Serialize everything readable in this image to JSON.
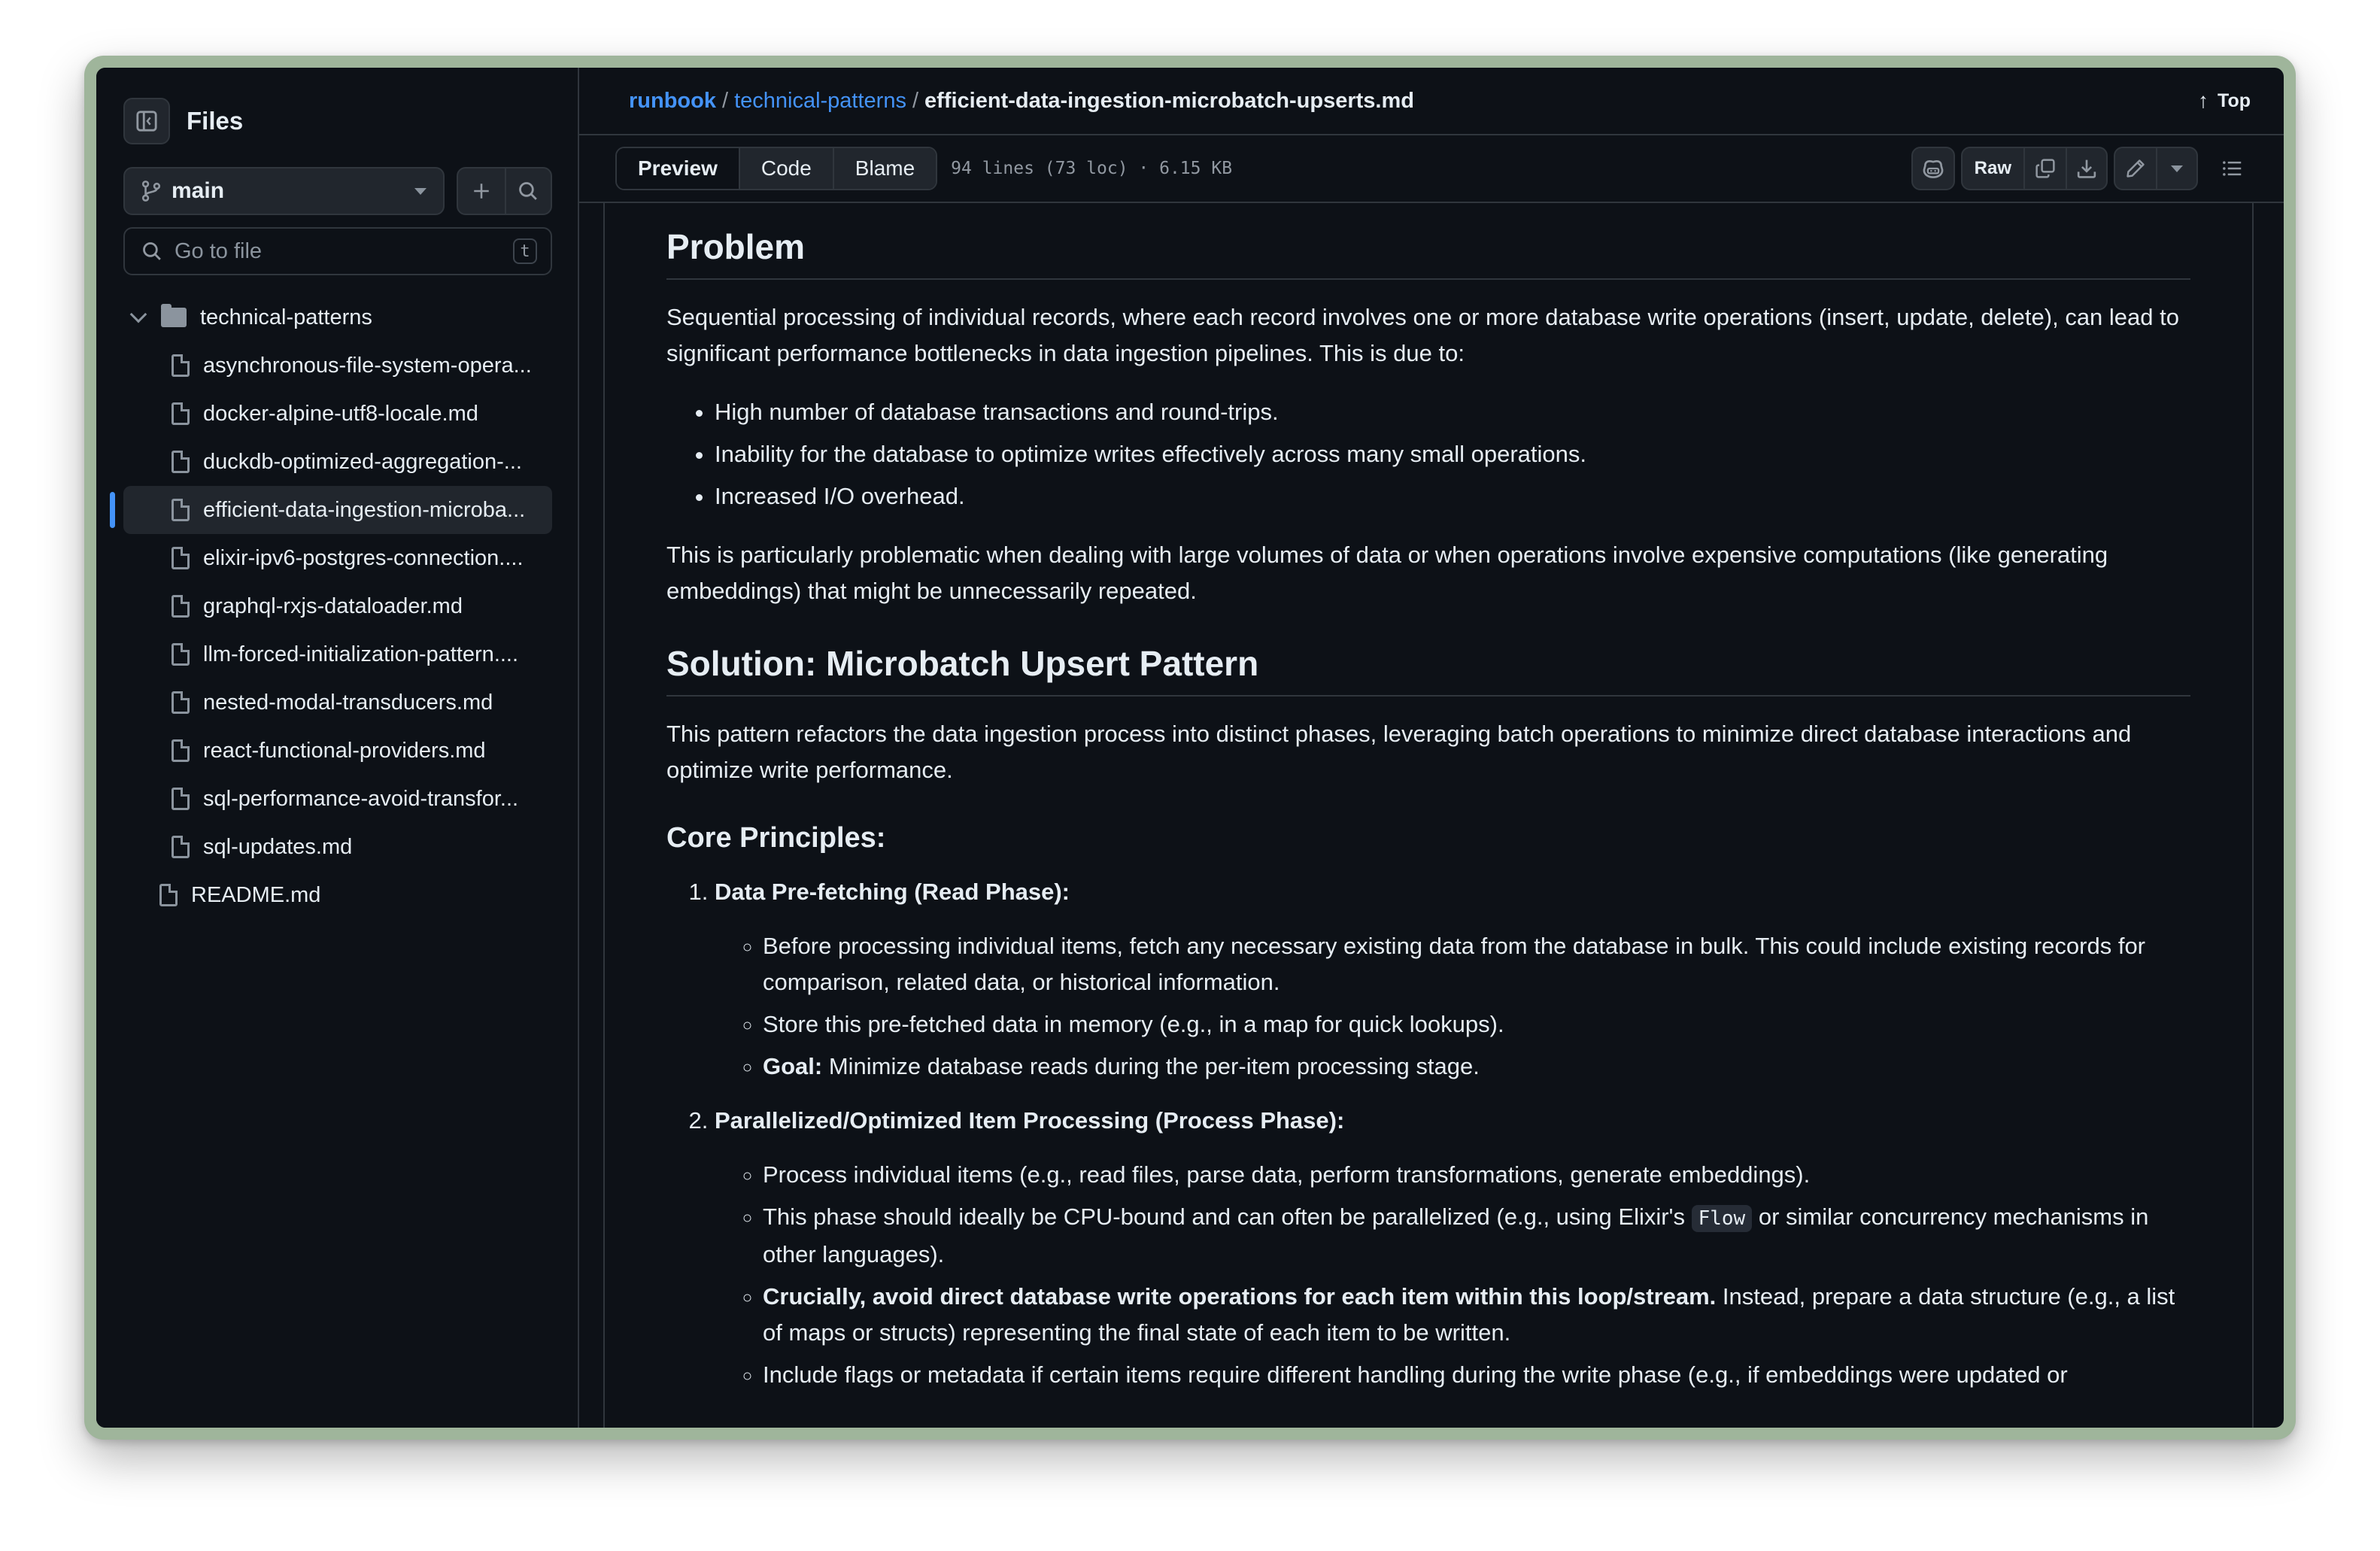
{
  "sidebar": {
    "title": "Files",
    "branch": "main",
    "search_placeholder": "Go to file",
    "search_shortcut": "t",
    "folder": "technical-patterns",
    "files": [
      "asynchronous-file-system-opera...",
      "docker-alpine-utf8-locale.md",
      "duckdb-optimized-aggregation-...",
      "efficient-data-ingestion-microba...",
      "elixir-ipv6-postgres-connection....",
      "graphql-rxjs-dataloader.md",
      "llm-forced-initialization-pattern....",
      "nested-modal-transducers.md",
      "react-functional-providers.md",
      "sql-performance-avoid-transfor...",
      "sql-updates.md"
    ],
    "active_file_index": 3,
    "root_file": "README.md"
  },
  "breadcrumb": {
    "repo": "runbook",
    "sep1": "/",
    "folder": "technical-patterns",
    "sep2": "/",
    "file": "efficient-data-ingestion-microbatch-upserts.md",
    "top_label": "Top"
  },
  "toolbar": {
    "tabs": [
      "Preview",
      "Code",
      "Blame"
    ],
    "active_tab": "Preview",
    "file_info": "94 lines (73 loc) · 6.15 KB",
    "raw_label": "Raw"
  },
  "doc": {
    "h_problem": "Problem",
    "p_problem": "Sequential processing of individual records, where each record involves one or more database write operations (insert, update, delete), can lead to significant performance bottlenecks in data ingestion pipelines. This is due to:",
    "problem_bullets": [
      "High number of database transactions and round-trips.",
      "Inability for the database to optimize writes effectively across many small operations.",
      "Increased I/O overhead."
    ],
    "p_problem2": "This is particularly problematic when dealing with large volumes of data or when operations involve expensive computations (like generating embeddings) that might be unnecessarily repeated.",
    "h_solution": "Solution: Microbatch Upsert Pattern",
    "p_solution": "This pattern refactors the data ingestion process into distinct phases, leveraging batch operations to minimize direct database interactions and optimize write performance.",
    "h_core": "Core Principles:",
    "step1": {
      "title": "Data Pre-fetching (Read Phase):",
      "b1": "Before processing individual items, fetch any necessary existing data from the database in bulk. This could include existing records for comparison, related data, or historical information.",
      "b2": "Store this pre-fetched data in memory (e.g., in a map for quick lookups).",
      "b3_strong": "Goal:",
      "b3_rest": " Minimize database reads during the per-item processing stage."
    },
    "step2": {
      "title": "Parallelized/Optimized Item Processing (Process Phase):",
      "b1": "Process individual items (e.g., read files, parse data, perform transformations, generate embeddings).",
      "b2_a": "This phase should ideally be CPU-bound and can often be parallelized (e.g., using Elixir's ",
      "b2_code": "Flow",
      "b2_b": " or similar concurrency mechanisms in other languages).",
      "b3_strong": "Crucially, avoid direct database write operations for each item within this loop/stream.",
      "b3_rest": " Instead, prepare a data structure (e.g., a list of maps or structs) representing the final state of each item to be written.",
      "b4": "Include flags or metadata if certain items require different handling during the write phase (e.g., if embeddings were updated or"
    }
  }
}
